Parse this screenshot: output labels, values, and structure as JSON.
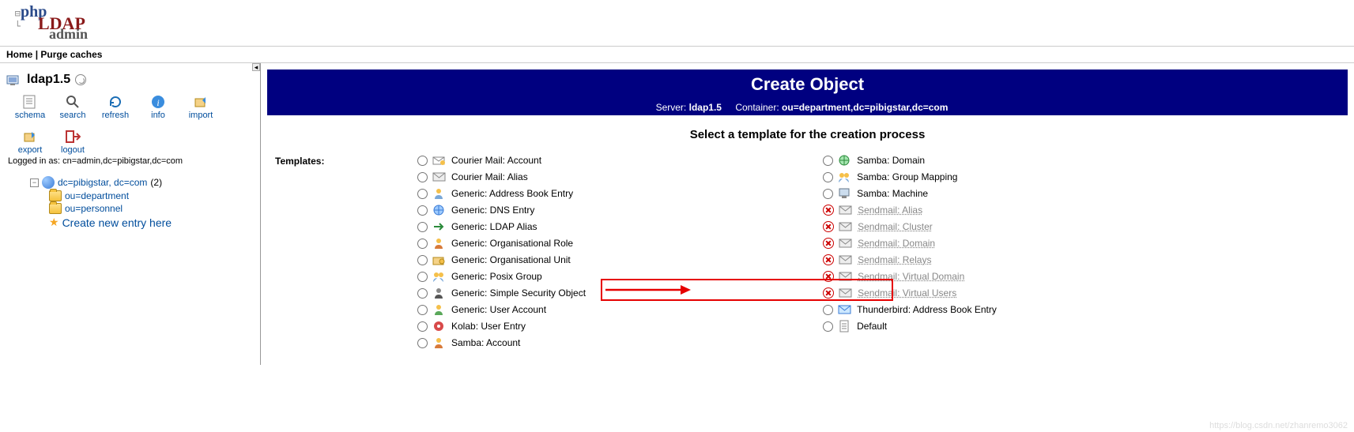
{
  "logo": {
    "php": "php",
    "ldap": "LDAP",
    "admin": "admin"
  },
  "nav": {
    "home": "Home",
    "purge": "Purge caches",
    "sep": " | "
  },
  "sidebar": {
    "server_name": "ldap1.5",
    "toolbar": [
      {
        "id": "schema",
        "label": "schema"
      },
      {
        "id": "search",
        "label": "search"
      },
      {
        "id": "refresh",
        "label": "refresh"
      },
      {
        "id": "info",
        "label": "info"
      },
      {
        "id": "import",
        "label": "import"
      },
      {
        "id": "export",
        "label": "export"
      },
      {
        "id": "logout",
        "label": "logout"
      }
    ],
    "logged_in_prefix": "Logged in as: ",
    "logged_in_dn": "cn=admin,dc=pibigstar,dc=com",
    "tree": {
      "root": "dc=pibigstar, dc=com",
      "root_count": "(2)",
      "children": [
        {
          "label": "ou=department"
        },
        {
          "label": "ou=personnel"
        },
        {
          "label": "Create new entry here",
          "star": true
        }
      ]
    }
  },
  "main": {
    "title": "Create Object",
    "server_label": "Server:",
    "server_value": "ldap1.5",
    "container_label": "Container:",
    "container_value": "ou=department,dc=pibigstar,dc=com",
    "instruction": "Select a template for the creation process",
    "templates_label": "Templates:",
    "col1": [
      {
        "label": "Courier Mail: Account",
        "icon": "mail-user"
      },
      {
        "label": "Courier Mail: Alias",
        "icon": "mail"
      },
      {
        "label": "Generic: Address Book Entry",
        "icon": "user"
      },
      {
        "label": "Generic: DNS Entry",
        "icon": "globe"
      },
      {
        "label": "Generic: LDAP Alias",
        "icon": "arrow"
      },
      {
        "label": "Generic: Organisational Role",
        "icon": "person"
      },
      {
        "label": "Generic: Organisational Unit",
        "icon": "folder-user"
      },
      {
        "label": "Generic: Posix Group",
        "icon": "group",
        "highlighted": true
      },
      {
        "label": "Generic: Simple Security Object",
        "icon": "person-dark"
      },
      {
        "label": "Generic: User Account",
        "icon": "person-green"
      },
      {
        "label": "Kolab: User Entry",
        "icon": "kolab"
      },
      {
        "label": "Samba: Account",
        "icon": "person"
      }
    ],
    "col2": [
      {
        "label": "Samba: Domain",
        "icon": "globe-net",
        "enabled": true
      },
      {
        "label": "Samba: Group Mapping",
        "icon": "group",
        "enabled": true
      },
      {
        "label": "Samba: Machine",
        "icon": "machine",
        "enabled": true
      },
      {
        "label": "Sendmail: Alias",
        "icon": "mail",
        "enabled": false
      },
      {
        "label": "Sendmail: Cluster",
        "icon": "mail",
        "enabled": false
      },
      {
        "label": "Sendmail: Domain",
        "icon": "mail",
        "enabled": false
      },
      {
        "label": "Sendmail: Relays",
        "icon": "mail",
        "enabled": false
      },
      {
        "label": "Sendmail: Virtual Domain",
        "icon": "mail",
        "enabled": false
      },
      {
        "label": "Sendmail: Virtual Users",
        "icon": "mail",
        "enabled": false
      },
      {
        "label": "Thunderbird: Address Book Entry",
        "icon": "tbird",
        "enabled": true
      },
      {
        "label": "Default",
        "icon": "doc",
        "enabled": true
      }
    ]
  },
  "watermark": "https://blog.csdn.net/zhanremo3062"
}
